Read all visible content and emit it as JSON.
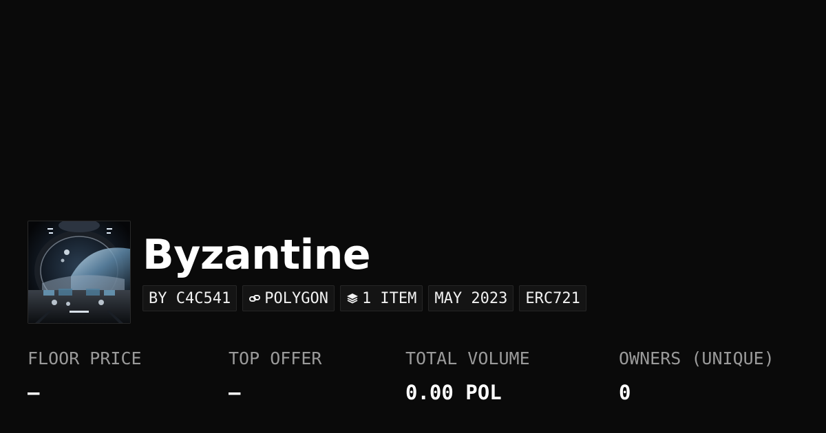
{
  "collection": {
    "name": "Byzantine",
    "badges": {
      "creator": "BY C4C541",
      "chain": "POLYGON",
      "items": "1 ITEM",
      "date": "MAY 2023",
      "standard": "ERC721"
    }
  },
  "stats": {
    "floor_price": {
      "label": "FLOOR PRICE",
      "value": "–"
    },
    "top_offer": {
      "label": "TOP OFFER",
      "value": "–"
    },
    "total_volume": {
      "label": "TOTAL VOLUME",
      "value": "0.00 POL"
    },
    "owners": {
      "label": "OWNERS (UNIQUE)",
      "value": "0"
    }
  },
  "icons": {
    "chain": "chain-link-icon",
    "items": "layers-icon"
  },
  "colors": {
    "background": "#0a0a0a",
    "badge_bg": "#141414",
    "label": "#9a9a9a",
    "text": "#ffffff"
  }
}
